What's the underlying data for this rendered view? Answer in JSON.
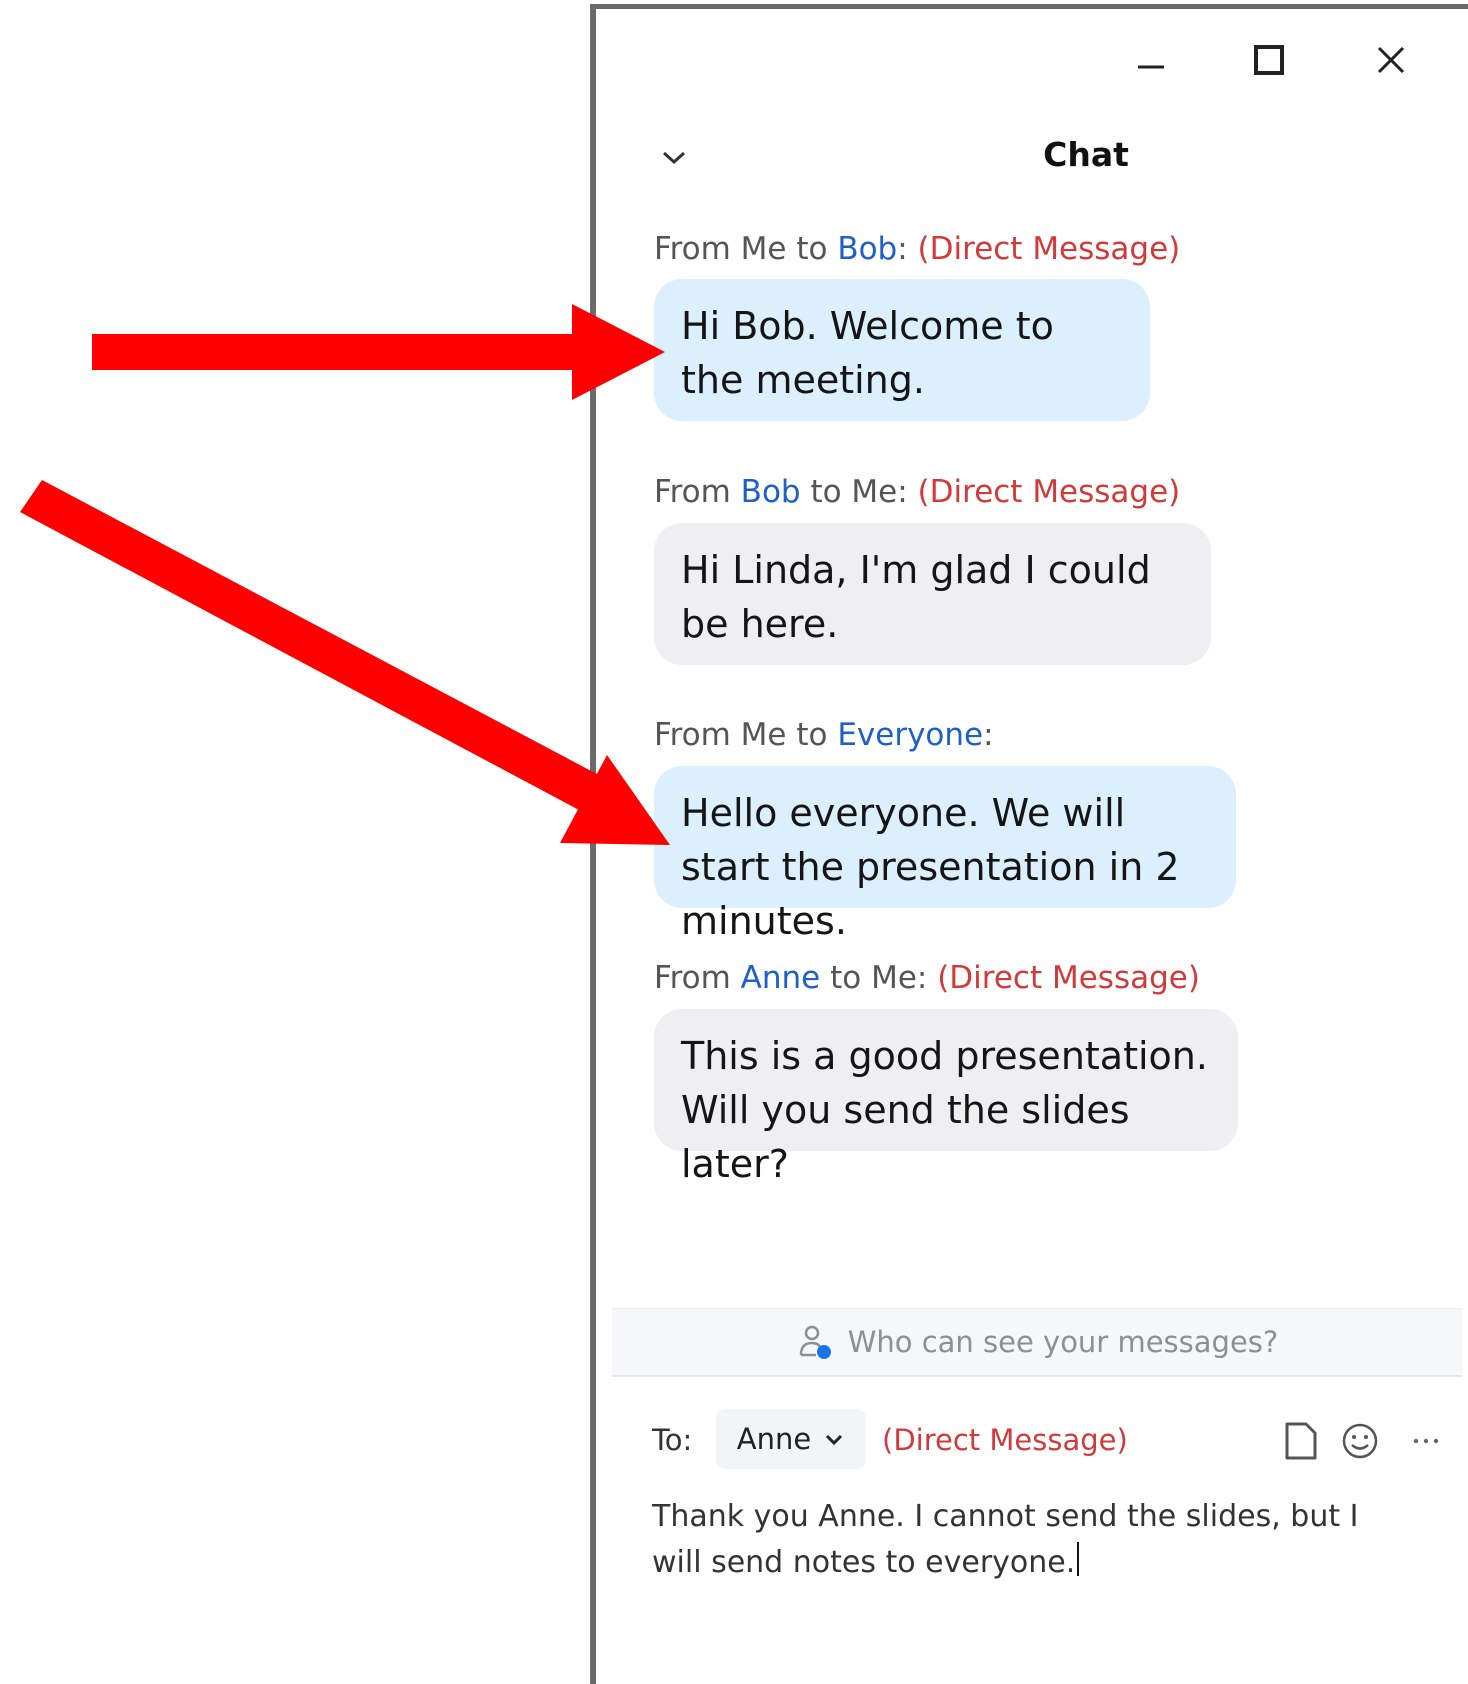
{
  "window_controls": {
    "minimize": "minimize-icon",
    "maximize": "maximize-icon",
    "close": "close-icon"
  },
  "chat": {
    "title": "Chat",
    "messages": [
      {
        "label_prefix": "From Me to ",
        "label_who": "Bob",
        "label_suffix": ": ",
        "dm": "(Direct Message)",
        "text": "Hi Bob.  Welcome to the meeting.",
        "mine": true
      },
      {
        "label_prefix": "From ",
        "label_who": "Bob",
        "label_suffix": " to Me: ",
        "dm": "(Direct Message)",
        "text": "Hi Linda, I'm glad I could be here.",
        "mine": false
      },
      {
        "label_prefix": "From Me to ",
        "label_who": "Everyone",
        "label_suffix": ":",
        "dm": "",
        "text": "Hello everyone.  We will start the presentation in 2 minutes.",
        "mine": true
      },
      {
        "label_prefix": "From ",
        "label_who": "Anne",
        "label_suffix": " to Me: ",
        "dm": "(Direct Message)",
        "text": "This is a good presentation. Will you send the slides later?",
        "mine": false
      }
    ]
  },
  "privacy_notice": "Who can see your messages?",
  "compose": {
    "to_label": "To:",
    "recipient": "Anne",
    "dm": "(Direct Message)",
    "text": "Thank you Anne.  I cannot send the slides, but I will send notes to everyone."
  },
  "colors": {
    "annotation_arrow": "#ff0000",
    "name_link": "#1f5fc8",
    "direct_message": "#d23a3a",
    "my_bubble": "#dceffd",
    "their_bubble": "#efeff1"
  }
}
